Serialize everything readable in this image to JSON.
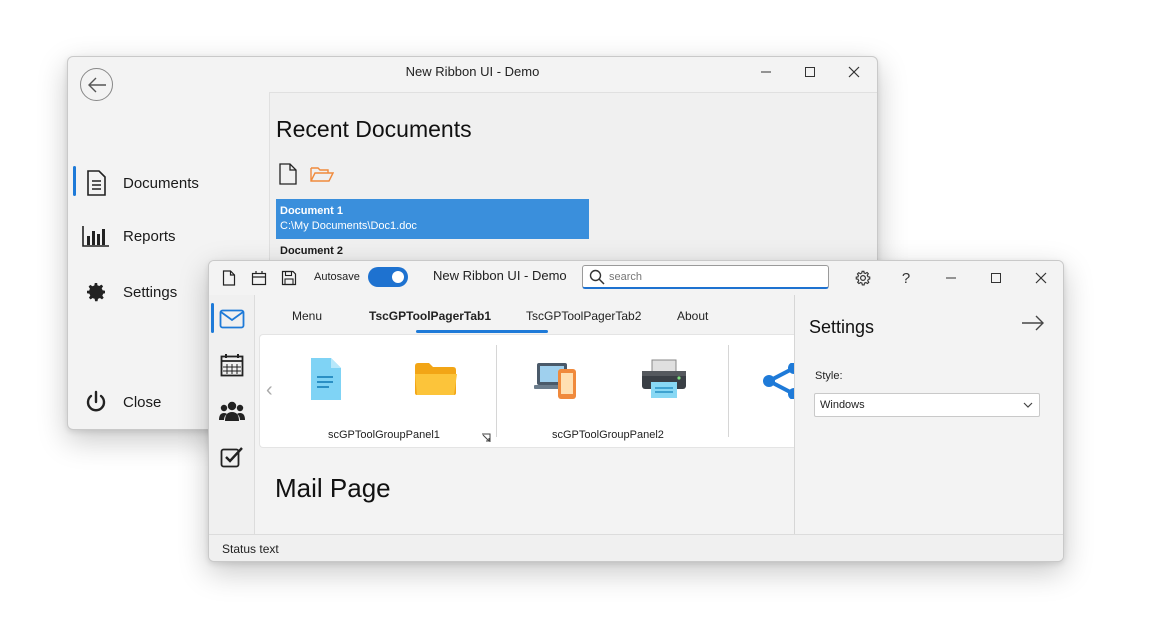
{
  "back_window": {
    "title": "New Ribbon UI - Demo",
    "backstage_items": [
      {
        "label": "Documents",
        "icon": "document-icon"
      },
      {
        "label": "Reports",
        "icon": "bar-chart-icon"
      },
      {
        "label": "Settings",
        "icon": "gear-icon"
      },
      {
        "label": "Close",
        "icon": "power-icon"
      }
    ],
    "recent_title": "Recent Documents",
    "documents": [
      {
        "name": "Document 1",
        "path": "C:\\My Documents\\Doc1.doc",
        "selected": true
      },
      {
        "name": "Document 2",
        "path": "",
        "selected": false
      }
    ]
  },
  "front_window": {
    "toolbar": {
      "autosave_label": "Autosave",
      "autosave_on": true,
      "title": "New Ribbon UI - Demo",
      "search_placeholder": "search"
    },
    "tabs": [
      {
        "label": "Menu",
        "active": false
      },
      {
        "label": "TscGPToolPagerTab1",
        "active": true
      },
      {
        "label": "TscGPToolPagerTab2",
        "active": false
      },
      {
        "label": "About",
        "active": false
      }
    ],
    "group_panels": [
      {
        "label": "scGPToolGroupPanel1"
      },
      {
        "label": "scGPToolGroupPanel2"
      }
    ],
    "page_title": "Mail Page",
    "settings_pane": {
      "title": "Settings",
      "style_label": "Style:",
      "style_value": "Windows"
    },
    "status_text": "Status text"
  },
  "colors": {
    "accent": "#1e7ad8",
    "selection": "#3a8fdc",
    "folder_orange": "#f08a3c"
  }
}
